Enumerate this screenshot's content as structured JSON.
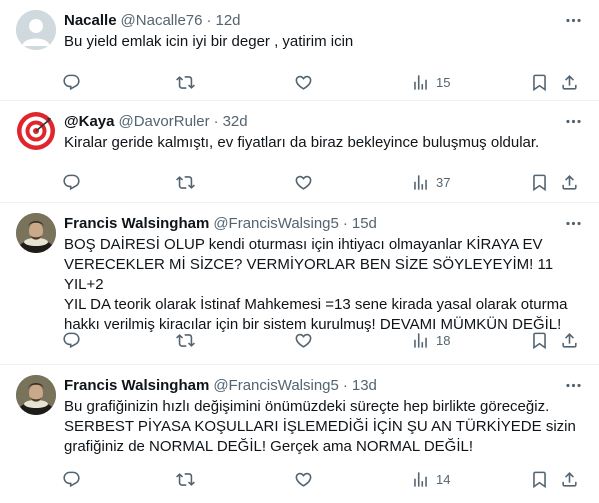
{
  "tweets": [
    {
      "name": "Nacalle",
      "handle": "@Nacalle76",
      "time": "12d",
      "text": "Bu yield emlak icin iyi bir deger , yatirim icin",
      "views": "15",
      "avatar": "default-avatar"
    },
    {
      "name": "@Kaya",
      "handle": "@DavorRuler",
      "time": "32d",
      "text": "Kiralar geride kalmıştı, ev fiyatları da biraz bekleyince buluşmuş oldular.",
      "views": "37",
      "avatar": "target-avatar"
    },
    {
      "name": "Francis Walsingham",
      "handle": "@FrancisWalsing5",
      "time": "15d",
      "text": "BOŞ DAİRESİ OLUP kendi oturması için ihtiyacı olmayanlar KİRAYA EV\nVERECEKLER Mİ SİZCE? VERMİYORLAR BEN SİZE SÖYLEYEYİM! 11 YIL+2\nYIL DA teorik olarak İstinaf Mahkemesi =13 sene kirada yasal olarak oturma\nhakkı verilmiş kiracılar için bir sistem kurulmuş! DEVAMI MÜMKÜN DEĞİL!",
      "views": "18",
      "avatar": "portrait-avatar"
    },
    {
      "name": "Francis Walsingham",
      "handle": "@FrancisWalsing5",
      "time": "13d",
      "text": "Bu grafiğinizin hızlı değişimini önümüzdeki süreçte hep birlikte göreceğiz.\nSERBEST PİYASA KOŞULLARI İŞLEMEDİĞİ İÇİN ŞU AN TÜRKİYEDE sizin\ngrafiğiniz de NORMAL DEĞİL! Gerçek ama NORMAL DEĞİL!",
      "views": "14",
      "avatar": "portrait-avatar"
    }
  ],
  "separator": "·",
  "colors": {
    "text": "#0f1419",
    "secondary": "#536471",
    "divider": "#eff3f4",
    "target_red": "#e0252c"
  }
}
